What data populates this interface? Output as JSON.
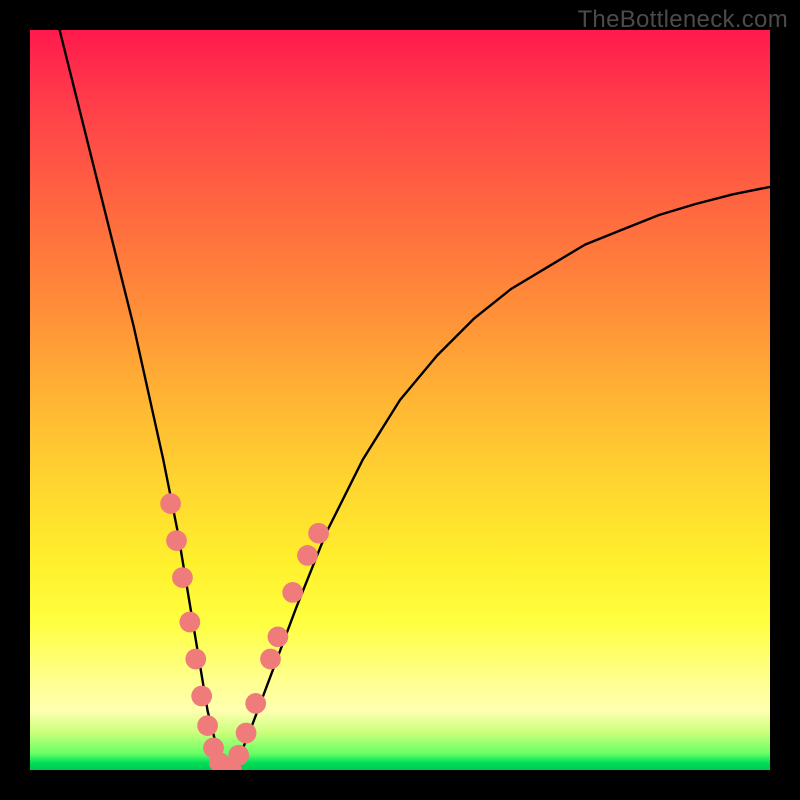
{
  "watermark": "TheBottleneck.com",
  "chart_data": {
    "type": "line",
    "title": "",
    "xlabel": "",
    "ylabel": "",
    "xlim": [
      0,
      100
    ],
    "ylim": [
      0,
      100
    ],
    "annotations": [],
    "legend": [],
    "background_gradient_stops": [
      {
        "pct": 0,
        "color": "#ff1a4d"
      },
      {
        "pct": 50,
        "color": "#ffb534"
      },
      {
        "pct": 80,
        "color": "#ffff40"
      },
      {
        "pct": 97,
        "color": "#66ff66"
      },
      {
        "pct": 100,
        "color": "#00c850"
      }
    ],
    "series": [
      {
        "name": "bottleneck-curve",
        "color": "#000000",
        "x": [
          4,
          6,
          8,
          10,
          12,
          14,
          16,
          18,
          20,
          22,
          23,
          24,
          25,
          26,
          27,
          28,
          30,
          33,
          36,
          40,
          45,
          50,
          55,
          60,
          65,
          70,
          75,
          80,
          85,
          90,
          95,
          100
        ],
        "y": [
          100,
          92,
          84,
          76,
          68,
          60,
          51,
          42,
          32,
          20,
          14,
          8,
          4,
          1,
          0,
          1,
          6,
          14,
          22,
          32,
          42,
          50,
          56,
          61,
          65,
          68,
          71,
          73,
          75,
          76.5,
          77.8,
          78.8
        ]
      }
    ],
    "markers": {
      "name": "highlight-dots",
      "color": "#ef7b7b",
      "radius_pct": 1.4,
      "points_xy": [
        [
          19.0,
          36
        ],
        [
          19.8,
          31
        ],
        [
          20.6,
          26
        ],
        [
          21.6,
          20
        ],
        [
          22.4,
          15
        ],
        [
          23.2,
          10
        ],
        [
          24.0,
          6
        ],
        [
          24.8,
          3
        ],
        [
          25.6,
          1
        ],
        [
          26.4,
          0
        ],
        [
          27.2,
          0
        ],
        [
          28.2,
          2
        ],
        [
          29.2,
          5
        ],
        [
          30.5,
          9
        ],
        [
          32.5,
          15
        ],
        [
          33.5,
          18
        ],
        [
          35.5,
          24
        ],
        [
          37.5,
          29
        ],
        [
          39.0,
          32
        ]
      ]
    }
  }
}
